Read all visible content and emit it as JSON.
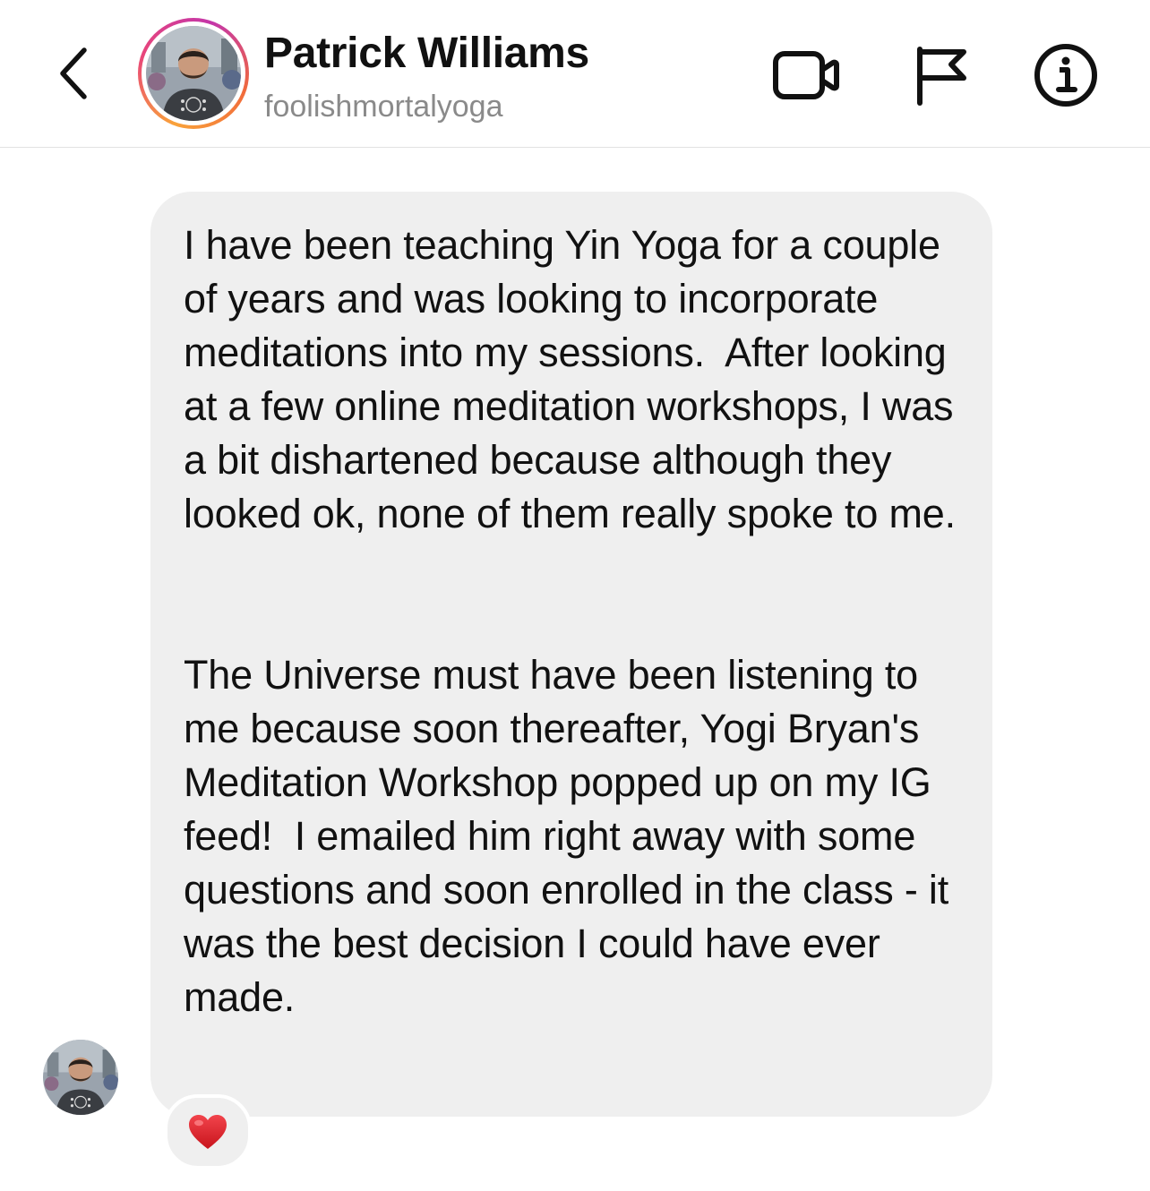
{
  "header": {
    "back_icon": "chevron-left-icon",
    "display_name": "Patrick Williams",
    "username": "foolishmortalyoga",
    "actions": [
      {
        "name": "video-call",
        "icon": "video-camera-icon"
      },
      {
        "name": "report",
        "icon": "flag-icon"
      },
      {
        "name": "info",
        "icon": "info-circle-icon"
      }
    ],
    "story_ring_colors": [
      "#f9a23a",
      "#e8457a",
      "#c436a9"
    ]
  },
  "message": {
    "paragraphs": [
      "I have been teaching Yin Yoga for a couple of years and was looking to incorporate meditations into my sessions.  After looking at a few online meditation workshops, I was a bit dishartened because although they looked ok, none of them really spoke to me.",
      "The Universe must have been listening to me because soon thereafter, Yogi Bryan's Meditation Workshop popped up on my IG feed!  I emailed him right away with some questions and soon enrolled in the class - it was the best decision I could have ever made."
    ],
    "bubble_color": "#efefef",
    "reaction": {
      "emoji": "❤️",
      "icon": "red-heart-icon",
      "color": "#e0202a"
    }
  }
}
